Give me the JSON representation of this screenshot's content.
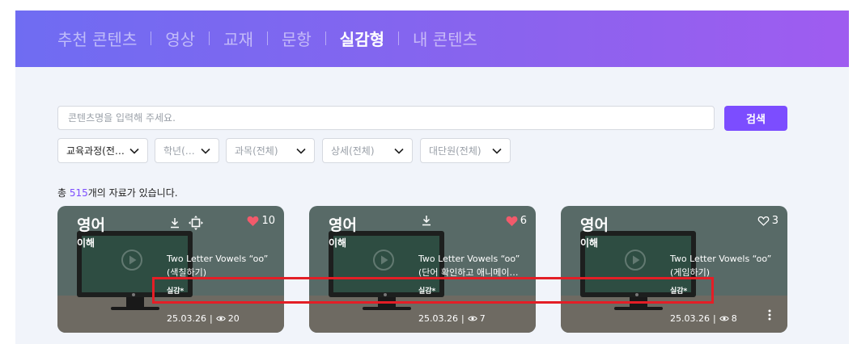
{
  "nav": {
    "items": [
      {
        "label": "추천 콘텐츠",
        "active": false
      },
      {
        "label": "영상",
        "active": false
      },
      {
        "label": "교재",
        "active": false
      },
      {
        "label": "문항",
        "active": false
      },
      {
        "label": "실감형",
        "active": true
      },
      {
        "label": "내 콘텐츠",
        "active": false
      }
    ]
  },
  "search": {
    "placeholder": "콘텐츠명을 입력해 주세요.",
    "value": "",
    "button_label": "검색"
  },
  "filters": [
    {
      "label": "교육과정(전…"
    },
    {
      "label": "학년(…"
    },
    {
      "label": "과목(전체)"
    },
    {
      "label": "상세(전체)"
    },
    {
      "label": "대단원(전체)"
    }
  ],
  "total": {
    "prefix": "총 ",
    "count": "515",
    "suffix": "개의 자료가 있습니다."
  },
  "cards": [
    {
      "subject": "영어",
      "category": "이해",
      "title_line1": "Two Letter Vowels “oo”",
      "title_line2": "(색칠하기)",
      "tag": "실감*",
      "date": "25.03.26",
      "views": "20",
      "likes": "10",
      "liked": true,
      "icons": [
        "download-icon",
        "move-icon"
      ],
      "has_more": false
    },
    {
      "subject": "영어",
      "category": "이해",
      "title_line1": "Two Letter Vowels “oo”",
      "title_line2": "(단어 확인하고 애니메이…",
      "tag": "실감*",
      "date": "25.03.26",
      "views": "7",
      "likes": "6",
      "liked": true,
      "icons": [
        "download-icon"
      ],
      "has_more": false
    },
    {
      "subject": "영어",
      "category": "이해",
      "title_line1": "Two Letter Vowels “oo”",
      "title_line2": "(게임하기)",
      "tag": "실감*",
      "date": "25.03.26",
      "views": "8",
      "likes": "3",
      "liked": false,
      "icons": [],
      "has_more": true
    }
  ],
  "colors": {
    "accent": "#7c4dff",
    "like": "#f25a6b",
    "highlight": "#e41e26"
  }
}
